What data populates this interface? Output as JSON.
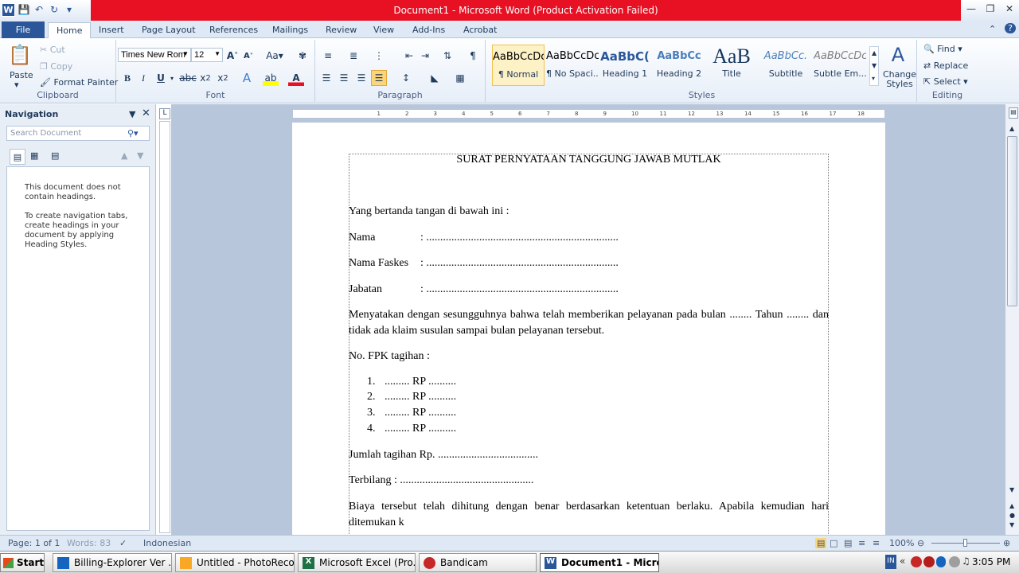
{
  "window": {
    "title": "Document1  -  Microsoft Word (Product Activation Failed)"
  },
  "tabs": [
    "File",
    "Home",
    "Insert",
    "Page Layout",
    "References",
    "Mailings",
    "Review",
    "View",
    "Add-Ins",
    "Acrobat"
  ],
  "clipboard": {
    "paste": "Paste",
    "cut": "Cut",
    "copy": "Copy",
    "format_painter": "Format Painter",
    "label": "Clipboard"
  },
  "font": {
    "name": "Times New Rom",
    "size": "12",
    "label": "Font"
  },
  "paragraph": {
    "label": "Paragraph"
  },
  "styles": {
    "label": "Styles",
    "items": [
      {
        "preview": "AaBbCcDc",
        "name": "¶ Normal"
      },
      {
        "preview": "AaBbCcDc",
        "name": "¶ No Spaci..."
      },
      {
        "preview": "AaBbC(",
        "name": "Heading 1"
      },
      {
        "preview": "AaBbCc",
        "name": "Heading 2"
      },
      {
        "preview": "AaB",
        "name": "Title"
      },
      {
        "preview": "AaBbCc.",
        "name": "Subtitle"
      },
      {
        "preview": "AaBbCcDc",
        "name": "Subtle Em..."
      }
    ],
    "change_styles": "Change Styles"
  },
  "editing": {
    "find": "Find",
    "replace": "Replace",
    "select": "Select",
    "label": "Editing"
  },
  "navigation": {
    "title": "Navigation",
    "search_placeholder": "Search Document",
    "msg1": "This document does not contain headings.",
    "msg2": "To create navigation tabs, create headings in your document by applying Heading Styles."
  },
  "document": {
    "heading": "SURAT PERNYATAAN TANGGUNG JAWAB MUTLAK",
    "intro": "Yang bertanda tangan di bawah ini :",
    "fields": [
      {
        "label": "Nama",
        "value": ": ....................................................................."
      },
      {
        "label": "Nama Faskes",
        "value": ": ....................................................................."
      },
      {
        "label": "Jabatan",
        "value": ": ....................................................................."
      }
    ],
    "statement": "Menyatakan dengan sesungguhnya bahwa telah memberikan pelayanan pada bulan ........ Tahun ........ dan tidak ada klaim susulan sampai bulan pelayanan tersebut.",
    "fpk": "No. FPK tagihan :",
    "list": [
      {
        "num": "1.",
        "text": "......... RP .........."
      },
      {
        "num": "2.",
        "text": "......... RP .........."
      },
      {
        "num": "3.",
        "text": "......... RP .........."
      },
      {
        "num": "4.",
        "text": "......... RP .........."
      }
    ],
    "jumlah": "Jumlah tagihan Rp. ....................................",
    "terbilang": "Terbilang  : ................................................",
    "closing": "Biaya tersebut telah dihitung dengan benar berdasarkan ketentuan berlaku. Apabila kemudian hari ditemukan k"
  },
  "status": {
    "page": "Page: 1 of 1",
    "words": "Words: 83",
    "language": "Indonesian",
    "zoom": "100%"
  },
  "taskbar": {
    "start": "Start",
    "items": [
      "Billing-Explorer Ver ...",
      "Untitled - PhotoRecord",
      "Microsoft Excel (Pro...",
      "Bandicam",
      "Document1 - Micro..."
    ],
    "time": "3:05 PM"
  },
  "colors": {
    "accent": "#2b579a",
    "titlebar": "#e81123",
    "workspace": "#b7c6da"
  }
}
